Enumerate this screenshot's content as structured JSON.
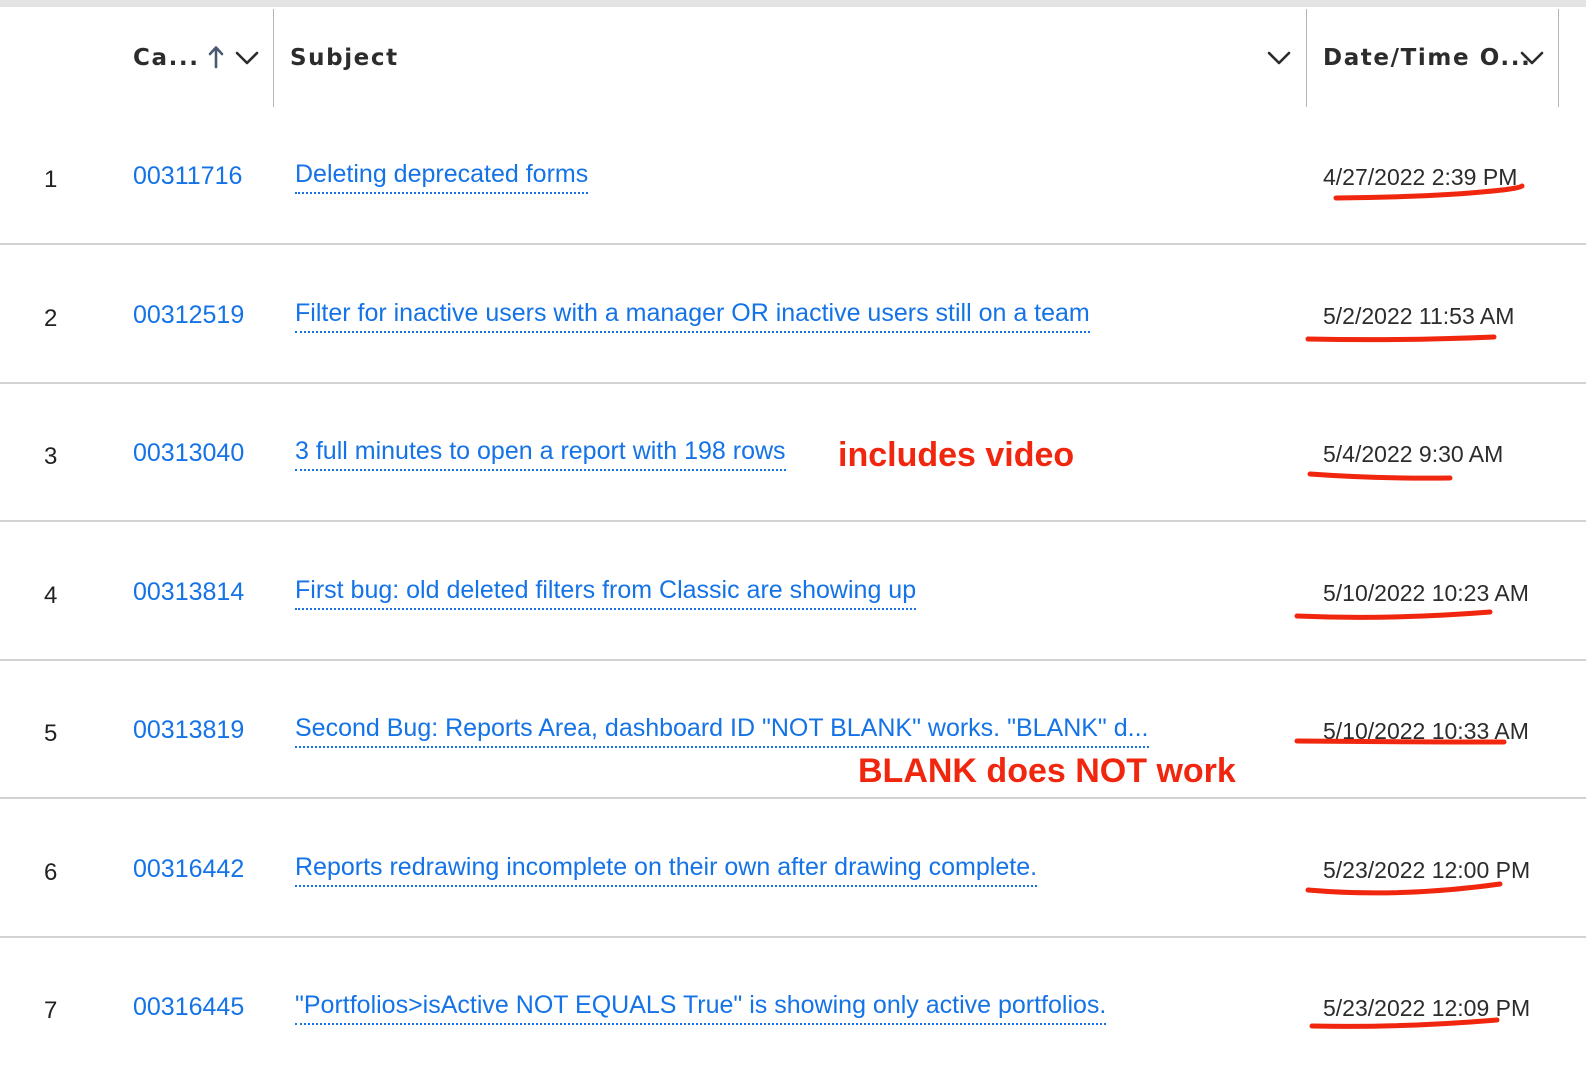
{
  "columns": {
    "case": {
      "label": "Ca...",
      "sort_icon": "arrow-up-icon",
      "menu_icon": "chevron-down-icon"
    },
    "subject": {
      "label": "Subject",
      "menu_icon": "chevron-down-icon"
    },
    "date": {
      "label": "Date/Time O...",
      "menu_icon": "chevron-down-icon"
    }
  },
  "rows": [
    {
      "num": "1",
      "case": "00311716",
      "subject": "Deleting deprecated forms",
      "date": "4/27/2022 2:39 PM"
    },
    {
      "num": "2",
      "case": "00312519",
      "subject": "Filter for inactive users with a manager OR inactive users still on a team",
      "date": "5/2/2022 11:53 AM"
    },
    {
      "num": "3",
      "case": "00313040",
      "subject": "3 full minutes to open a report with 198 rows",
      "date": "5/4/2022 9:30 AM"
    },
    {
      "num": "4",
      "case": "00313814",
      "subject": "First bug: old deleted filters from Classic are showing up",
      "date": "5/10/2022 10:23 AM"
    },
    {
      "num": "5",
      "case": "00313819",
      "subject": "Second Bug: Reports Area, dashboard ID \"NOT BLANK\" works. \"BLANK\" d...",
      "date": "5/10/2022 10:33 AM"
    },
    {
      "num": "6",
      "case": "00316442",
      "subject": "Reports redrawing incomplete on their own after drawing complete.",
      "date": "5/23/2022 12:00 PM"
    },
    {
      "num": "7",
      "case": "00316445",
      "subject": "\"Portfolios>isActive NOT EQUALS True\" is showing only active portfolios.",
      "date": "5/23/2022 12:09 PM"
    }
  ],
  "annotations": {
    "includes_video": "includes video",
    "blank_note": "BLANK does NOT work",
    "color": "#f0270e"
  },
  "colors": {
    "link": "#1473e6",
    "text": "#2c2c2c",
    "divider": "#d2d2d2",
    "annotation": "#f0270e"
  }
}
